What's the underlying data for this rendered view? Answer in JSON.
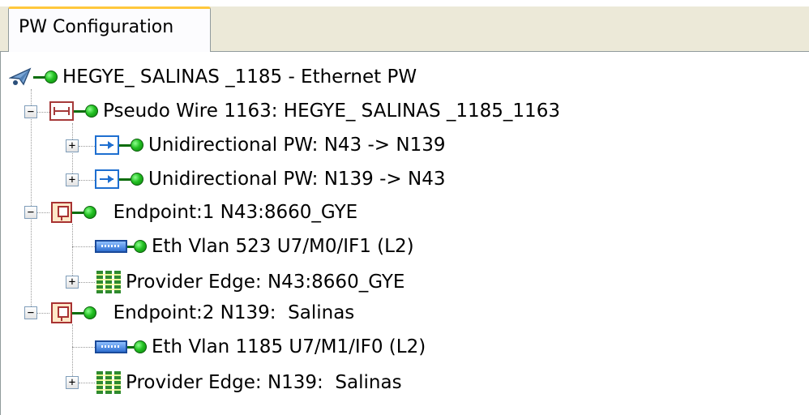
{
  "tab": {
    "label": "PW Configuration"
  },
  "tree": {
    "root": {
      "label": "HEGYE_  SALINAS  _1185 - Ethernet PW",
      "icon": "satellite-dish-icon"
    },
    "pseudo_wire": {
      "label": "Pseudo Wire 1163: HEGYE_  SALINAS  _1185_1163",
      "icon": "pseudo-wire-icon"
    },
    "uni_pw_1": {
      "label": "Unidirectional PW: N43 -> N139",
      "icon": "unidirectional-pw-icon"
    },
    "uni_pw_2": {
      "label": "Unidirectional PW: N139 -> N43",
      "icon": "unidirectional-pw-icon"
    },
    "endpoint_1": {
      "label": "  Endpoint:1 N43:8660_GYE",
      "icon": "endpoint-icon"
    },
    "eth_vlan_1": {
      "label": "Eth Vlan 523 U7/M0/IF1 (L2)",
      "icon": "ethernet-port-icon"
    },
    "provider_edge_1": {
      "label": "Provider Edge: N43:8660_GYE",
      "icon": "provider-edge-icon"
    },
    "endpoint_2": {
      "label": "  Endpoint:2 N139:  Salinas",
      "icon": "endpoint-icon"
    },
    "eth_vlan_2": {
      "label": "Eth Vlan 1185 U7/M1/IF0 (L2)",
      "icon": "ethernet-port-icon"
    },
    "provider_edge_2": {
      "label": "Provider Edge: N139:  Salinas",
      "icon": "provider-edge-icon"
    },
    "expanders": {
      "collapse": "−",
      "expand": "+"
    }
  },
  "colors": {
    "tab_highlight": "#ffc83c",
    "status_ok": "#22c022",
    "tab_bar_bg": "#ece9d8"
  }
}
